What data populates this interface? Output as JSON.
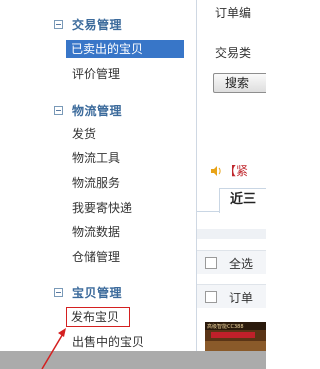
{
  "sidebar": {
    "top_group_title": "交易管理",
    "top_group_items": [
      "已卖出的宝贝",
      "评价管理"
    ],
    "logistics_title": "物流管理",
    "logistics_items": [
      "发货",
      "物流工具",
      "物流服务",
      "我要寄快递",
      "物流数据",
      "仓储管理"
    ],
    "goods_title": "宝贝管理",
    "goods_items": [
      "发布宝贝",
      "出售中的宝贝"
    ]
  },
  "right": {
    "order_label": "订单编",
    "trade_label": "交易类",
    "search_button": "搜索",
    "notice": "【紧",
    "tab_label": "近三",
    "select_all": "全选",
    "order_row": "订单",
    "product_tag": "高级智能CC388"
  },
  "colors": {
    "selected_bg": "#3876c8",
    "section_title": "#3b6a9b",
    "highlight_border": "#d42020",
    "notice_red": "#c0282e"
  }
}
